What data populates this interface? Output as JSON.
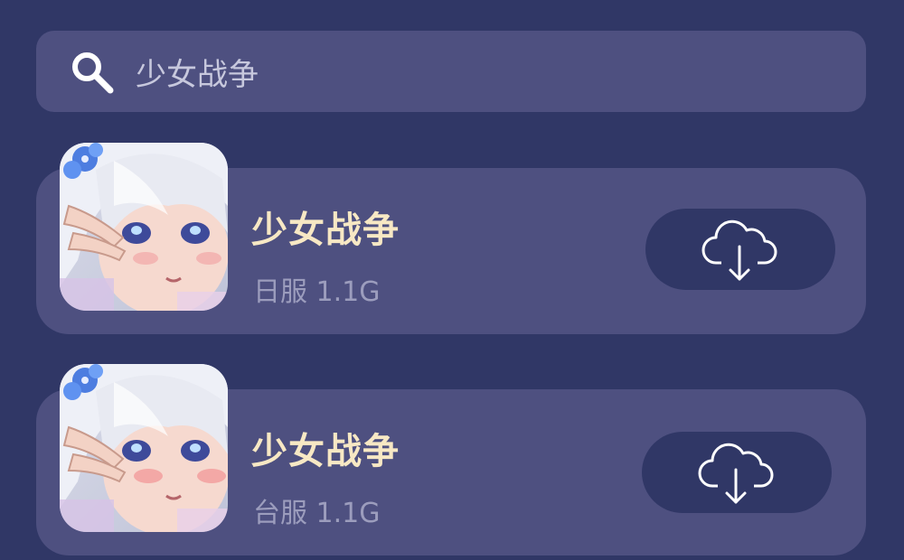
{
  "search": {
    "value": "少女战争",
    "icon": "search-icon"
  },
  "apps": [
    {
      "title": "少女战争",
      "meta": "日服 1.1G",
      "icon": "anime-girl-app-icon",
      "action_icon": "cloud-download-icon"
    },
    {
      "title": "少女战争",
      "meta": "台服 1.1G",
      "icon": "anime-girl-app-icon",
      "action_icon": "cloud-download-icon"
    }
  ],
  "colors": {
    "background": "#303766",
    "card": "#4e5080",
    "title": "#f7e8c4",
    "meta": "#9c9dbd"
  }
}
